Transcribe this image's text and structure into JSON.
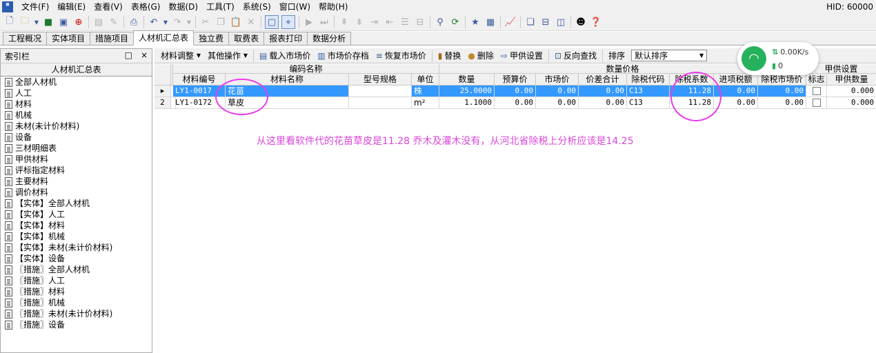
{
  "menu": {
    "items": [
      "文件(F)",
      "编辑(E)",
      "查看(V)",
      "表格(G)",
      "数据(D)",
      "工具(T)",
      "系统(S)",
      "窗口(W)",
      "帮助(H)"
    ],
    "hid": "HID: 60000"
  },
  "tabs": [
    "工程概况",
    "实体项目",
    "措施项目",
    "人材机汇总表",
    "独立费",
    "取费表",
    "报表打印",
    "数据分析"
  ],
  "active_tab": "人材机汇总表",
  "left_panel": {
    "title": "索引栏",
    "subtitle": "人材机汇总表",
    "pin_glyph": "□",
    "close_glyph": "×",
    "items": [
      "全部人材机",
      "人工",
      "材料",
      "机械",
      "未材(未计价材料)",
      "设备",
      "三材明细表",
      "甲供材料",
      "评标指定材料",
      "主要材料",
      "调价材料",
      "【实体】全部人材机",
      "【实体】人工",
      "【实体】材料",
      "【实体】机械",
      "【实体】未材(未计价材料)",
      "【实体】设备",
      "〖措施〗全部人材机",
      "〖措施〗人工",
      "〖措施〗材料",
      "〖措施〗机械",
      "〖措施〗未材(未计价材料)",
      "〖措施〗设备"
    ]
  },
  "subtoolbar": {
    "material_adjust": "材料调整",
    "other_ops": "其他操作",
    "load_price": "载入市场价",
    "save_price": "市场价存档",
    "restore_price": "恢复市场价",
    "replace": "替换",
    "delete": "删除",
    "supply_setting": "甲供设置",
    "reverse_find": "反向查找",
    "sort_label": "排序",
    "sort_value": "默认排序"
  },
  "grid": {
    "group_headers": {
      "code_name": "编码名称",
      "qty_price": "数量价格",
      "supply": "甲供设置"
    },
    "columns": [
      "材料编号",
      "材料名称",
      "型号规格",
      "单位",
      "数量",
      "预算价",
      "市场价",
      "价差合计",
      "除税代码",
      "除税系数",
      "进项税额",
      "除税市场价",
      "标志",
      "甲供数量"
    ],
    "rows": [
      {
        "index": "▸",
        "code": "LY1-0017",
        "name": "花苗",
        "spec": "",
        "unit": "株",
        "qty": "25.0000",
        "budget": "0.00",
        "market": "0.00",
        "diff": "0.00",
        "taxcode": "C13",
        "taxcoef": "11.28",
        "inputtax": "0.00",
        "exmarket": "0.00",
        "supplyqty": "0.000"
      },
      {
        "index": "2",
        "code": "LY1-0172",
        "name": "草皮",
        "spec": "",
        "unit": "m²",
        "qty": "1.1000",
        "budget": "0.00",
        "market": "0.00",
        "diff": "0.00",
        "taxcode": "C13",
        "taxcoef": "11.28",
        "inputtax": "0.00",
        "exmarket": "0.00",
        "supplyqty": "0.000"
      }
    ]
  },
  "annotation": "从这里看软件代的花苗草皮是11.28   乔木及灌木没有，从河北省除税上分析应该是14.25",
  "net_widget": {
    "speed": "0.00K/s",
    "count": "0"
  },
  "colors": {
    "selection": "#3399ff",
    "annotation": "#d946d9",
    "net_green": "#26b15c"
  }
}
